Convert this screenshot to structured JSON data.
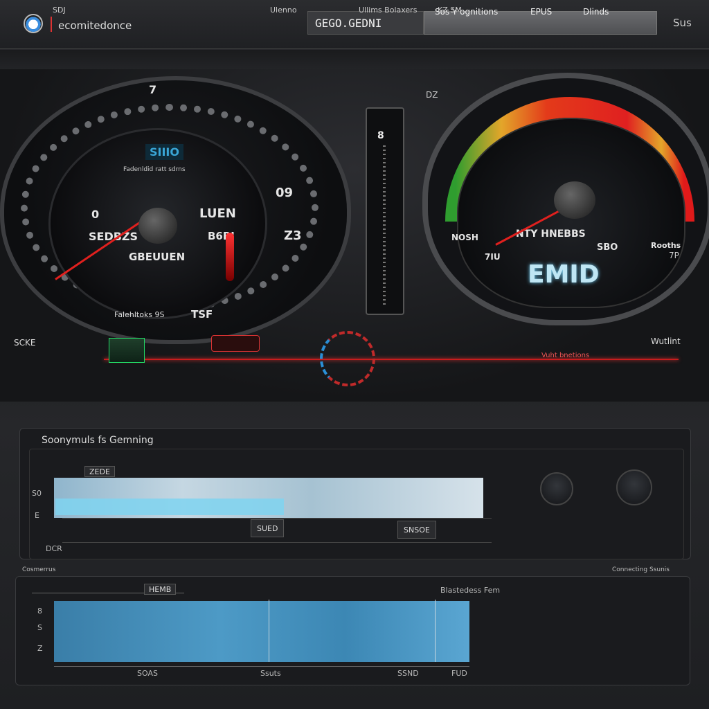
{
  "header": {
    "app_title": "ecomitedonce",
    "search_value": "GEGO.GEDNI",
    "nav": [
      "Sos Y ognitions",
      "EPUS",
      "Dlinds"
    ],
    "top_right": "Sus"
  },
  "subbar": {
    "left": "SDJ",
    "center": "Ulenno",
    "tab1": "Ullims Bolaxers",
    "tab2": "KZ SM"
  },
  "dashboard": {
    "left_gauge": {
      "top_label": "7",
      "screen_label": "SIIIO",
      "subtitle": "Fadenldid ratt sdrns",
      "left_value": "0",
      "left_value2": "SEDBZS",
      "center_label": "LUEN",
      "mid_value": "B6BI",
      "bottom_label": "GBEUUEN",
      "right_value": "09",
      "right_value2": "Z3",
      "footer_left": "Falehltoks 9S",
      "footer_right": "TSF"
    },
    "center_bar": {
      "value": "8"
    },
    "right_gauge": {
      "top_label": "DZ",
      "left_label": "NOSH",
      "center_label": "NTY HNEBBS",
      "small_left": "7IU",
      "small_right": "SBO",
      "big_label": "EMID",
      "right_label": "Rooths",
      "right_sub": "7P"
    },
    "side_left": "SCKE",
    "side_right": "Wutlint",
    "line_label": "Vuht bnetions"
  },
  "diagnostics": {
    "title": "Soonymuls fs Gemning",
    "corner": "DCR",
    "chip_left": "ZEDE",
    "chip_center": "SUED",
    "chip_right": "SNSOE",
    "y_label1": "S0",
    "y_label2": "E"
  },
  "lower": {
    "left_caption": "Cosmerrus",
    "right_caption": "Connecting Ssunis",
    "chart_tag": "HEMB",
    "chart_tag_right": "Blastedess Fem",
    "axis": [
      "SOAS",
      "Ssuts",
      "SSND",
      "FUD"
    ],
    "y_labels": [
      "8",
      "S",
      "Z"
    ]
  },
  "colors": {
    "accent_red": "#c81d1d",
    "accent_blue": "#7fd3f0",
    "gauge_green": "#2f9d2f",
    "gauge_yellow": "#e3a62a"
  }
}
